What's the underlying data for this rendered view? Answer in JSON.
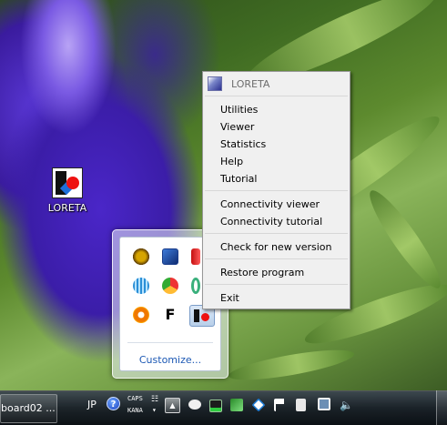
{
  "desktop": {
    "icon_label": "LORETA"
  },
  "context_menu": {
    "header": "LORETA",
    "groups": [
      [
        "Utilities",
        "Viewer",
        "Statistics",
        "Help",
        "Tutorial"
      ],
      [
        "Connectivity viewer",
        "Connectivity tutorial"
      ],
      [
        "Check for new version"
      ],
      [
        "Restore program"
      ],
      [
        "Exit"
      ]
    ]
  },
  "overflow_panel": {
    "customize_label": "Customize..."
  },
  "taskbar": {
    "task_button_label": "board02 ...",
    "language": "JP",
    "caps_label": "CAPS",
    "kana_label": "KANA"
  },
  "colors": {
    "menu_bg": "#f0f0f0",
    "link_blue": "#1c58b4"
  }
}
